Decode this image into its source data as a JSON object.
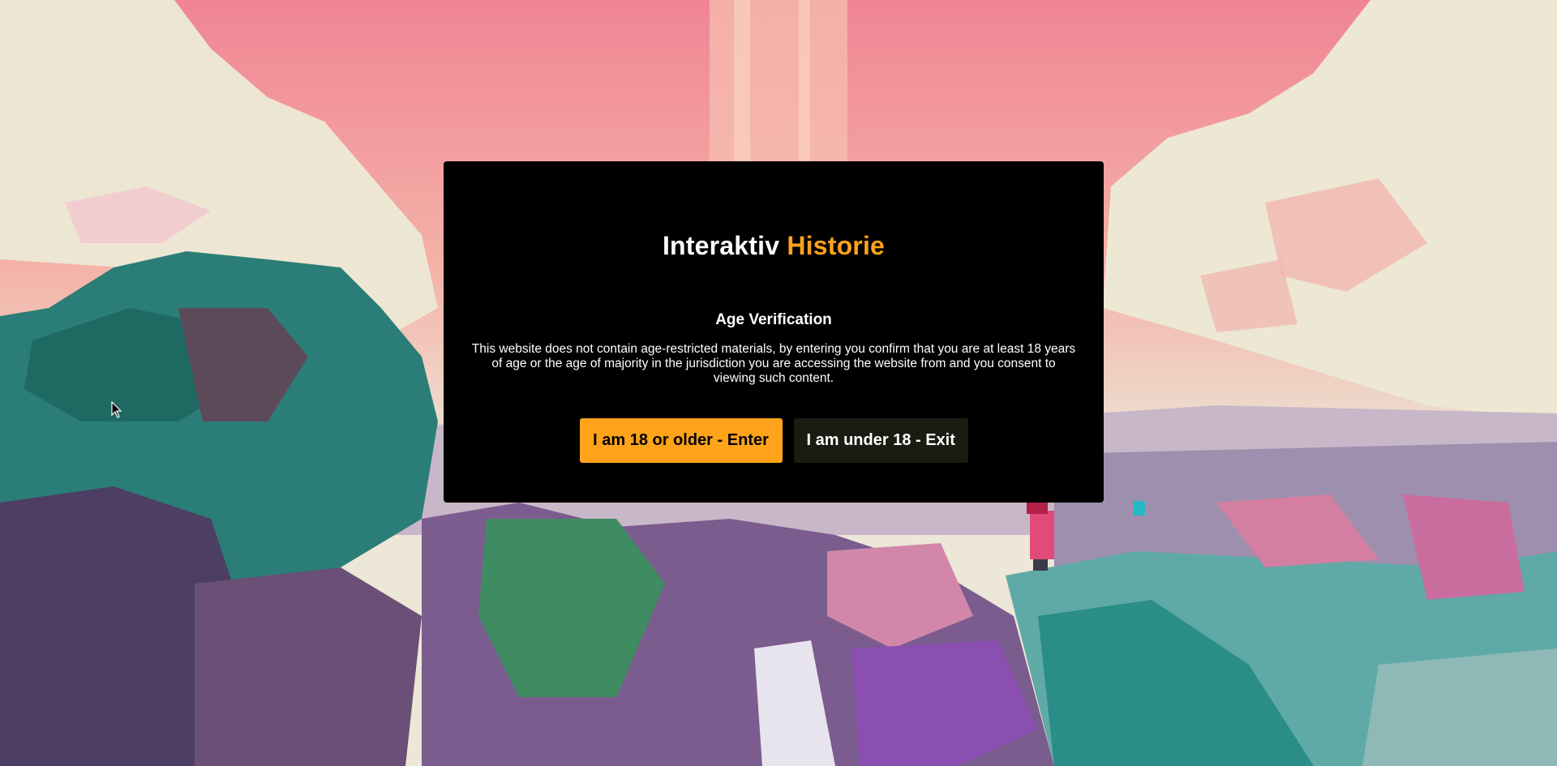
{
  "background": {
    "icon": "pixel-art-landscape",
    "sky_colors": [
      "#f08a96",
      "#f3b3aa",
      "#ede9d9"
    ],
    "foliage_colors": [
      "#2d7f78",
      "#1e6b66",
      "#7a5a8c",
      "#d780a0"
    ]
  },
  "modal": {
    "brand_part1": "Interaktiv ",
    "brand_part2": "Historie",
    "heading": "Age Verification",
    "notice": "This website does not contain age-restricted materials, by entering you confirm that you are at least 18 years of age or the age of majority in the jurisdiction you are accessing the website from and you consent to viewing such content.",
    "enter_label": "I am 18 or older - Enter",
    "exit_label": "I am under 18 - Exit"
  },
  "colors": {
    "accent": "#ffa31a",
    "modal_bg": "#000000",
    "exit_bg": "#1b1b12"
  },
  "cursor": {
    "icon": "mouse-pointer-icon"
  }
}
